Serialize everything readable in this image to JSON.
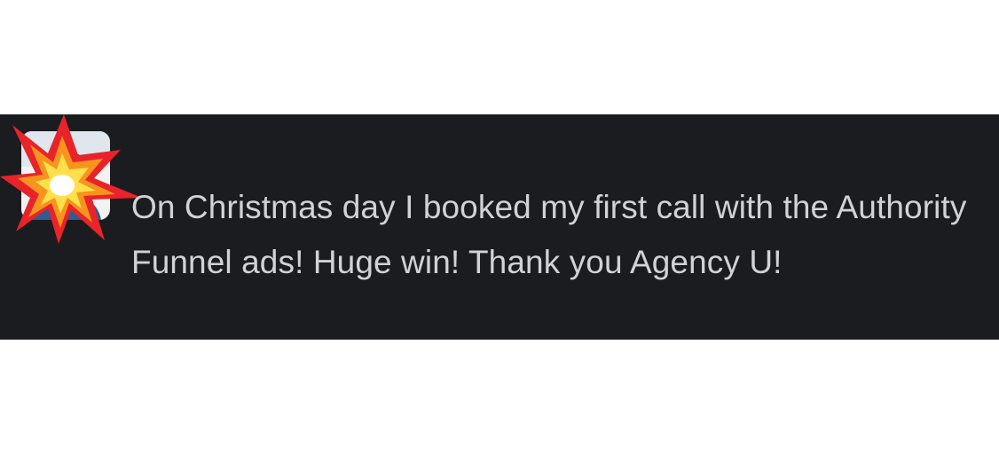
{
  "message": {
    "text": "On Christmas day I booked my first call with the Authority Funnel ads! Huge win! Thank you Agency U!"
  },
  "avatar": {
    "icon": "user-avatar"
  },
  "reaction": {
    "icon": "collision-emoji",
    "colors": {
      "outer": "#e8232a",
      "middle": "#f7941d",
      "inner": "#ffe04a",
      "core": "#ffffff"
    }
  },
  "theme": {
    "panel_background": "#1b1c1f",
    "text_color": "#d1d2d3"
  }
}
